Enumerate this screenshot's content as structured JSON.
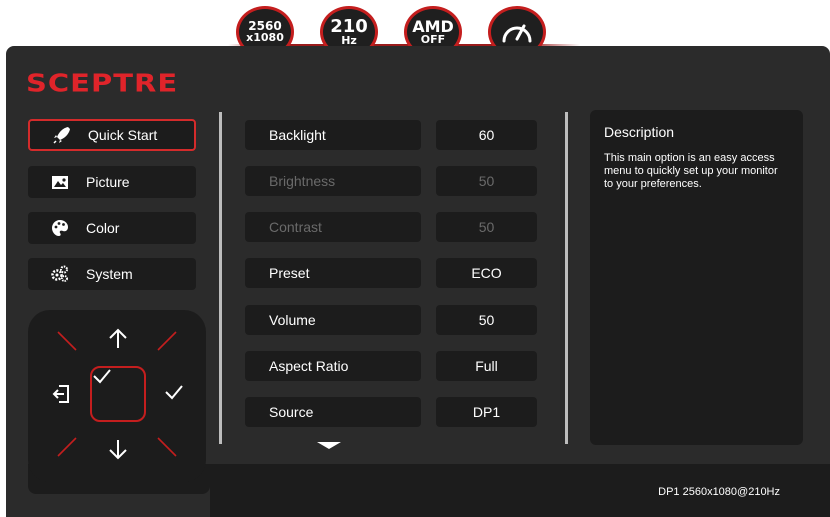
{
  "badges": {
    "resolution": {
      "line1": "2560",
      "line2": "x1080"
    },
    "refresh": {
      "line1": "210",
      "line2": "Hz"
    },
    "amd": {
      "line1": "AMD",
      "line2": "OFF"
    },
    "speed_icon": "speedometer-icon"
  },
  "brand": {
    "logo": "SCEPTRE",
    "accent_color": "#e0242a"
  },
  "menu": {
    "items": [
      {
        "label": "Quick Start",
        "icon": "rocket-icon",
        "active": true
      },
      {
        "label": "Picture",
        "icon": "picture-icon",
        "active": false
      },
      {
        "label": "Color",
        "icon": "palette-icon",
        "active": false
      },
      {
        "label": "System",
        "icon": "gears-icon",
        "active": false
      }
    ]
  },
  "settings": [
    {
      "label": "Backlight",
      "value": "60",
      "enabled": true
    },
    {
      "label": "Brightness",
      "value": "50",
      "enabled": false
    },
    {
      "label": "Contrast",
      "value": "50",
      "enabled": false
    },
    {
      "label": "Preset",
      "value": "ECO",
      "enabled": true
    },
    {
      "label": "Volume",
      "value": "50",
      "enabled": true
    },
    {
      "label": "Aspect Ratio",
      "value": "Full",
      "enabled": true
    },
    {
      "label": "Source",
      "value": "DP1",
      "enabled": true
    }
  ],
  "description": {
    "title": "Description",
    "text": "This main option is an easy access menu to quickly set up your monitor to your preferences."
  },
  "status": {
    "text": "DP1  2560x1080@210Hz"
  }
}
